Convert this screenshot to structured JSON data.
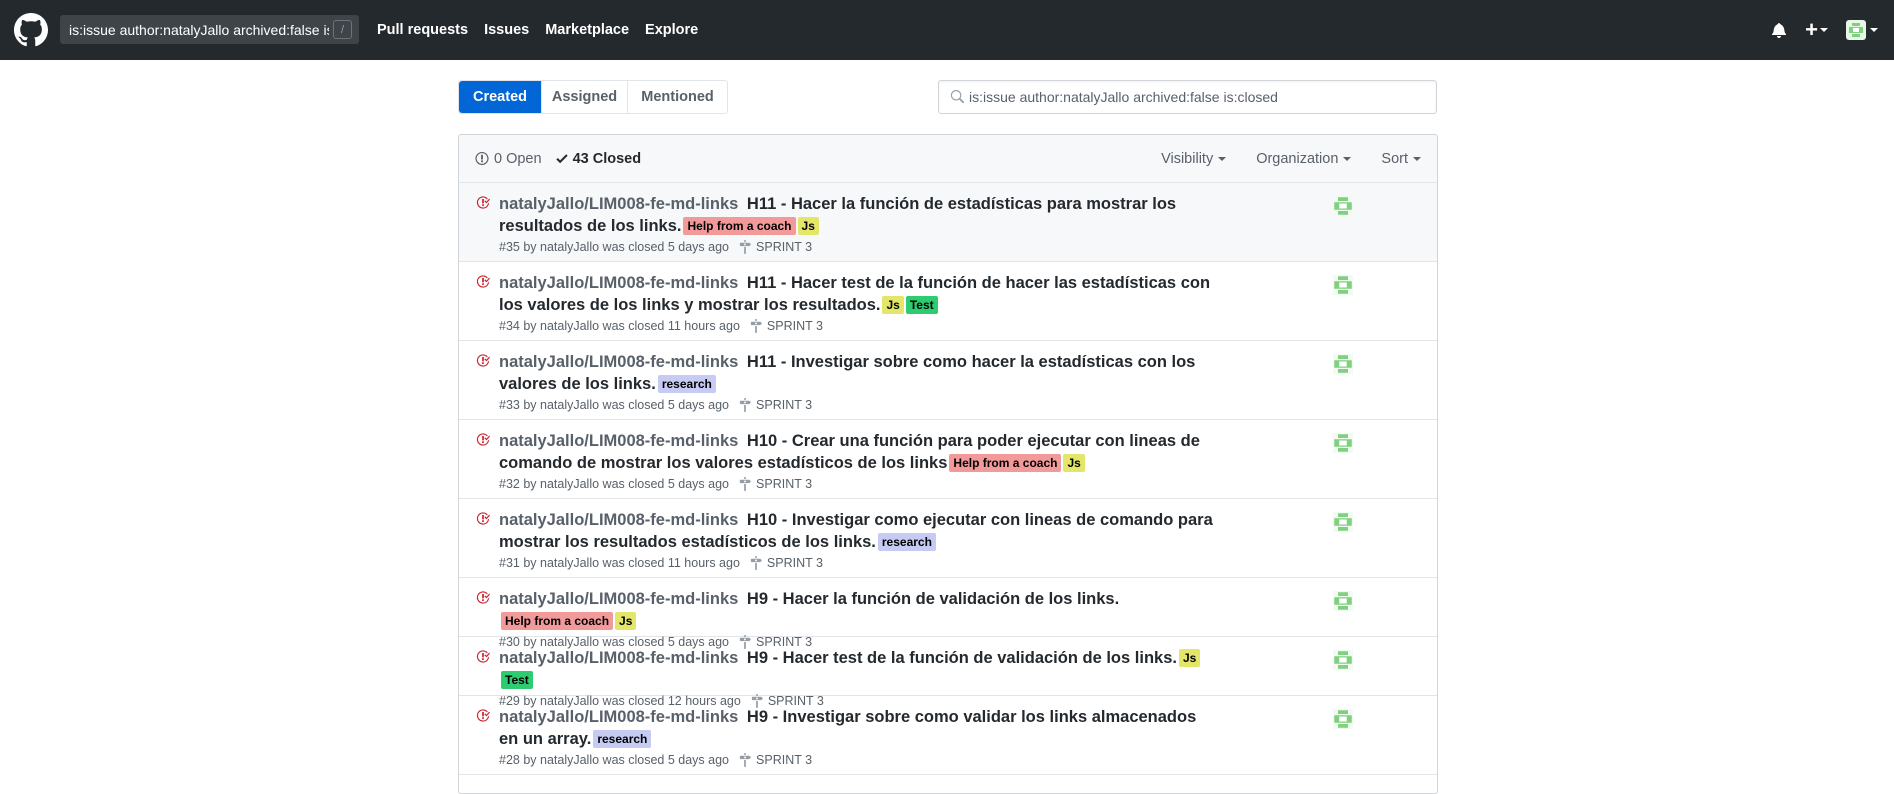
{
  "header": {
    "search_value": "is:issue author:natalyJallo archived:false is:clo",
    "search_key": "/",
    "nav": [
      "Pull requests",
      "Issues",
      "Marketplace",
      "Explore"
    ],
    "icons": [
      "github-logo-icon",
      "bell-icon",
      "plus-icon",
      "avatar-icon"
    ]
  },
  "tabs": [
    "Created",
    "Assigned",
    "Mentioned"
  ],
  "issue_search": {
    "value": "is:issue author:natalyJallo archived:false is:closed"
  },
  "box_header": {
    "open": "0 Open",
    "closed": "43 Closed",
    "filters": [
      "Visibility",
      "Organization",
      "Sort"
    ]
  },
  "issues": [
    {
      "repo": "natalyJallo/LIM008-fe-md-links",
      "title": "H11 - Hacer la función de estadísticas para mostrar los resultados de los links.",
      "labels": [
        {
          "text": "Help from a coach",
          "cls": "lbl-help"
        },
        {
          "text": "Js",
          "cls": "lbl-js"
        }
      ],
      "meta": "#35 by natalyJallo was closed 5 days ago",
      "milestone": "SPRINT 3"
    },
    {
      "repo": "natalyJallo/LIM008-fe-md-links",
      "title": "H11 - Hacer test de la función de hacer las estadísticas con los valores de los links y mostrar los resultados.",
      "labels": [
        {
          "text": "Js",
          "cls": "lbl-js"
        },
        {
          "text": "Test",
          "cls": "lbl-test"
        }
      ],
      "meta": "#34 by natalyJallo was closed 11 hours ago",
      "milestone": "SPRINT 3"
    },
    {
      "repo": "natalyJallo/LIM008-fe-md-links",
      "title": "H11 - Investigar sobre como hacer la estadísticas con los valores de los links.",
      "labels": [
        {
          "text": "research",
          "cls": "lbl-research"
        }
      ],
      "meta": "#33 by natalyJallo was closed 5 days ago",
      "milestone": "SPRINT 3"
    },
    {
      "repo": "natalyJallo/LIM008-fe-md-links",
      "title": "H10 - Crear una función para poder ejecutar con lineas de comando de mostrar los valores estadísticos de los links",
      "labels": [
        {
          "text": "Help from a coach",
          "cls": "lbl-help"
        },
        {
          "text": "Js",
          "cls": "lbl-js"
        }
      ],
      "meta": "#32 by natalyJallo was closed 5 days ago",
      "milestone": "SPRINT 3"
    },
    {
      "repo": "natalyJallo/LIM008-fe-md-links",
      "title": "H10 - Investigar como ejecutar con lineas de comando para mostrar los resultados estadísticos de los links.",
      "labels": [
        {
          "text": "research",
          "cls": "lbl-research"
        }
      ],
      "meta": "#31 by natalyJallo was closed 11 hours ago",
      "milestone": "SPRINT 3"
    },
    {
      "repo": "natalyJallo/LIM008-fe-md-links",
      "title": "H9 - Hacer la función de validación de los links.",
      "labels": [
        {
          "text": "Help from a coach",
          "cls": "lbl-help"
        },
        {
          "text": "Js",
          "cls": "lbl-js"
        }
      ],
      "meta": "#30 by natalyJallo was closed 5 days ago",
      "milestone": "SPRINT 3"
    },
    {
      "repo": "natalyJallo/LIM008-fe-md-links",
      "title": "H9 - Hacer test de la función de validación de los links.",
      "labels": [
        {
          "text": "Js",
          "cls": "lbl-js"
        },
        {
          "text": "Test",
          "cls": "lbl-test"
        }
      ],
      "meta": "#29 by natalyJallo was closed 12 hours ago",
      "milestone": "SPRINT 3"
    },
    {
      "repo": "natalyJallo/LIM008-fe-md-links",
      "title": "H9 - Investigar sobre como validar los links almacenados en un array.",
      "labels": [
        {
          "text": "research",
          "cls": "lbl-research"
        }
      ],
      "meta": "#28 by natalyJallo was closed 5 days ago",
      "milestone": "SPRINT 3"
    }
  ],
  "colors": {
    "header_bg": "#24292e",
    "accent": "#0366d6",
    "closed_icon": "#cb2431"
  }
}
